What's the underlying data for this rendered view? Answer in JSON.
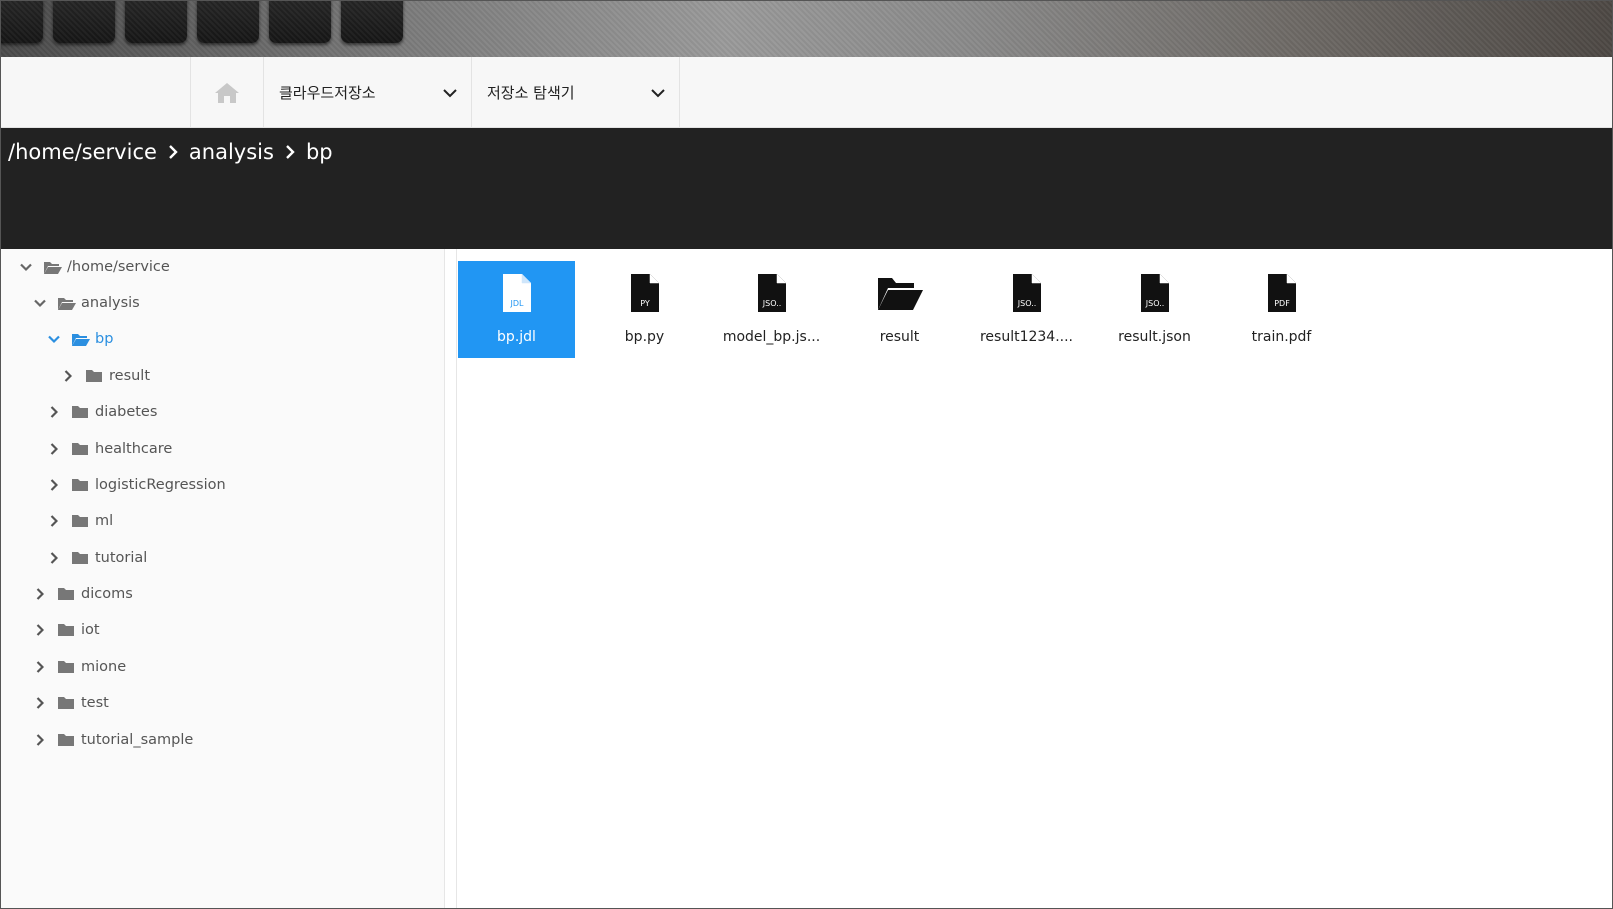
{
  "navbar": {
    "home_icon": "home-icon",
    "menu1_label": "클라우드저장소",
    "menu2_label": "저장소 탐색기"
  },
  "breadcrumb": {
    "items": [
      "/home/service",
      "analysis",
      "bp"
    ]
  },
  "tree": {
    "rows": [
      {
        "label": "/home/service",
        "state": "expanded"
      },
      {
        "label": "analysis",
        "state": "expanded"
      },
      {
        "label": "bp",
        "state": "expanded",
        "active": true
      },
      {
        "label": "result",
        "state": "collapsed"
      },
      {
        "label": "diabetes",
        "state": "collapsed"
      },
      {
        "label": "healthcare",
        "state": "collapsed"
      },
      {
        "label": "logisticRegression",
        "state": "collapsed"
      },
      {
        "label": "ml",
        "state": "collapsed"
      },
      {
        "label": "tutorial",
        "state": "collapsed"
      },
      {
        "label": "dicoms",
        "state": "collapsed"
      },
      {
        "label": "iot",
        "state": "collapsed"
      },
      {
        "label": "mione",
        "state": "collapsed"
      },
      {
        "label": "test",
        "state": "collapsed"
      },
      {
        "label": "tutorial_sample",
        "state": "collapsed"
      }
    ]
  },
  "files": [
    {
      "name": "bp.jdl",
      "type": "JDL",
      "selected": true
    },
    {
      "name": "bp.py",
      "type": "PY"
    },
    {
      "name": "model_bp.js...",
      "type": "JSO.."
    },
    {
      "name": "result",
      "type": "folder"
    },
    {
      "name": "result1234....",
      "type": "JSO.."
    },
    {
      "name": "result.json",
      "type": "JSO.."
    },
    {
      "name": "train.pdf",
      "type": "PDF"
    }
  ],
  "colors": {
    "accent": "#2196f3",
    "active_tree": "#2b8fe0",
    "breadcrumb_bg": "#222222"
  }
}
